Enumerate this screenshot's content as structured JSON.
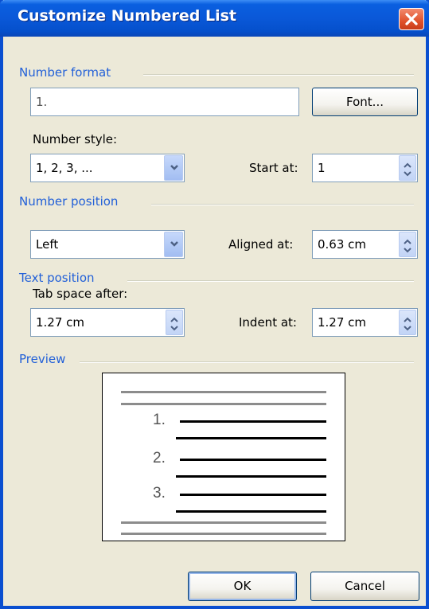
{
  "window": {
    "title": "Customize Numbered List"
  },
  "number_format": {
    "group_label": "Number format",
    "format_value": "1.",
    "font_button_label": "Font...",
    "style_label": "Number style:",
    "style_value": "1, 2, 3, ...",
    "start_label": "Start at:",
    "start_value": "1"
  },
  "number_position": {
    "group_label": "Number position",
    "alignment_value": "Left",
    "aligned_label": "Aligned at:",
    "aligned_value": "0.63 cm"
  },
  "text_position": {
    "group_label": "Text position",
    "tab_label": "Tab space after:",
    "tab_value": "1.27 cm",
    "indent_label": "Indent at:",
    "indent_value": "1.27 cm"
  },
  "preview": {
    "group_label": "Preview",
    "numbers": [
      "1.",
      "2.",
      "3."
    ]
  },
  "buttons": {
    "ok": "OK",
    "cancel": "Cancel"
  },
  "colors": {
    "titlebar": "#0a58d8",
    "group_label": "#2260d8",
    "face": "#ece9d8",
    "close": "#e0522c"
  }
}
